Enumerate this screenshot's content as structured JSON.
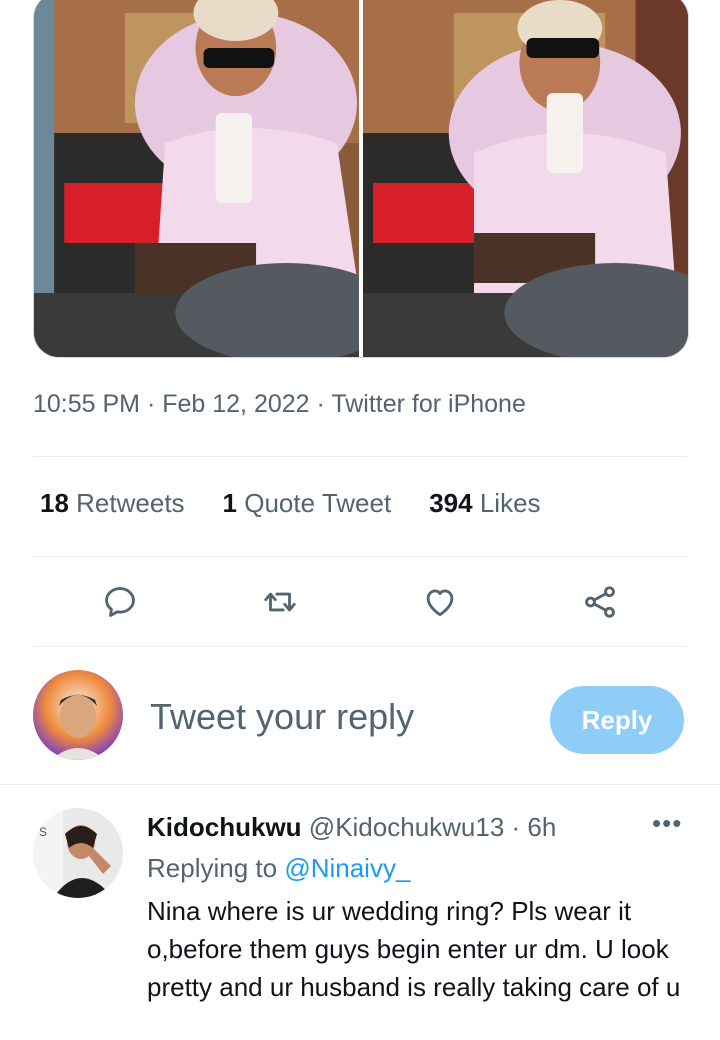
{
  "tweet": {
    "timestamp": "10:55 PM · Feb 12, 2022 · Twitter for iPhone",
    "stats": {
      "retweets_count": "18",
      "retweets_label": "Retweets",
      "quotes_count": "1",
      "quotes_label": "Quote Tweet",
      "likes_count": "394",
      "likes_label": "Likes"
    },
    "actions": [
      {
        "icon": "reply-icon"
      },
      {
        "icon": "retweet-icon"
      },
      {
        "icon": "like-icon"
      },
      {
        "icon": "share-icon"
      }
    ]
  },
  "composer": {
    "placeholder": "Tweet your reply",
    "button_label": "Reply"
  },
  "reply": {
    "display_name": "Kidochukwu",
    "handle_time": "@Kidochukwu13 · 6h",
    "more": "•••",
    "replying_prefix": "Replying to",
    "replying_mention": "@Ninaivy_",
    "text": "Nina where is ur wedding ring? Pls wear it o,before them guys begin enter ur dm. U look pretty and ur husband is really taking care of u"
  },
  "colors": {
    "accent": "#1d9bf0",
    "reply_button": "#8ecdf8",
    "secondary_text": "#536471"
  }
}
